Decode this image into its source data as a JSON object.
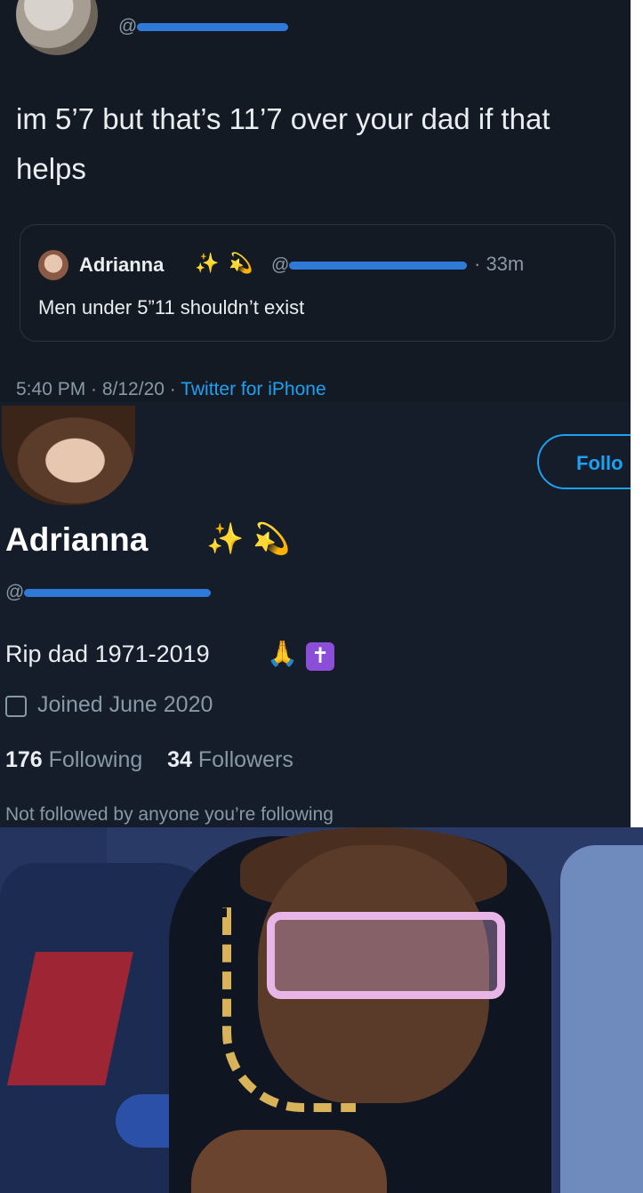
{
  "tweet": {
    "handle_prefix": "@",
    "text": "im 5’7 but that’s 11’7 over your dad if that helps",
    "quote": {
      "name": "Adrianna",
      "emoji_sparkles": "✨",
      "emoji_star": "💫",
      "handle_prefix": "@",
      "time": "· 33m",
      "text": "Men under 5”11 shouldn’t exist"
    },
    "meta_time": "5:40 PM · 8/12/20 · ",
    "meta_app": "Twitter for iPhone"
  },
  "profile": {
    "follow_label": "Follo",
    "name": "Adrianna",
    "emoji_sparkles": "✨",
    "emoji_star": "💫",
    "handle_prefix": "@",
    "bio": "Rip dad 1971-2019",
    "bio_emoji_pray": "🙏",
    "bio_emoji_cross": "✝",
    "joined": "Joined June 2020",
    "following_count": "176",
    "following_label": "Following",
    "followers_count": "34",
    "followers_label": "Followers",
    "not_followed": "Not followed by anyone you’re following"
  },
  "colors": {
    "background": "#141a24",
    "accent": "#1da1f2",
    "redaction": "#2f7ad9",
    "muted_text": "#8899a6"
  }
}
